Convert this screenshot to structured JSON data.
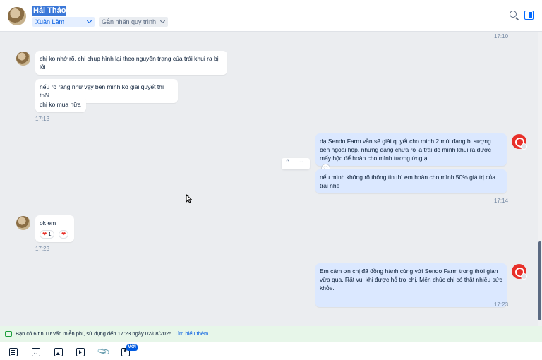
{
  "header": {
    "contact_name": "Hải Thảo",
    "assigned_user": "Xuân Lâm",
    "process_placeholder": "Gắn nhãn quy trình"
  },
  "messages": {
    "top_time": "17:10",
    "group1": {
      "texts": [
        "chị ko nhớ rõ, chỉ chụp hình lại theo nguyên trạng của trái khui ra bị lỗi",
        "nếu rõ ràng như vậy bên mình ko giải quyết thì thôi",
        "chị ko mua nữa"
      ],
      "time": "17:13"
    },
    "group2": {
      "texts": [
        "dạ Sendo Farm vẫn sẽ giải quyết cho mình 2 múi đang bị sượng bên ngoài hộp, nhưng đang chưa rõ là trái đó mình khui ra được mấy hộc để hoàn cho mình tương ứng ạ",
        "nếu mình không rõ thông tin thì em hoàn cho mình 50% giá trị của trái nhé"
      ],
      "time": "17:14"
    },
    "group3": {
      "text": "ok em",
      "reaction_count": "1",
      "time": "17:23"
    },
    "group4": {
      "text": "Em cảm ơn chị đã đồng hành cùng với Sendo Farm trong thời gian vừa qua. Rất vui khi được hỗ trợ chị. Mến chúc chị có thật nhiều sức khỏe.",
      "time": "17:23"
    }
  },
  "notice": {
    "text": "Bạn có 6 tin Tư vấn miễn phí, sử dụng đến 17:23 ngày 02/08/2025.",
    "link": "Tìm hiểu thêm"
  },
  "toolbar": {
    "new_badge": "MỚI"
  },
  "icons": [
    "search-icon",
    "side-panel-icon",
    "quote-icon",
    "more-icon",
    "heart-icon",
    "chat-icon",
    "document-icon",
    "sticker-icon",
    "image-icon",
    "video-icon",
    "attachment-icon",
    "new-feature-icon"
  ],
  "colors": {
    "accent": "#0068ff",
    "outgoing_bubble": "#dbe8ff",
    "notice_bg": "#e7f6e9"
  }
}
